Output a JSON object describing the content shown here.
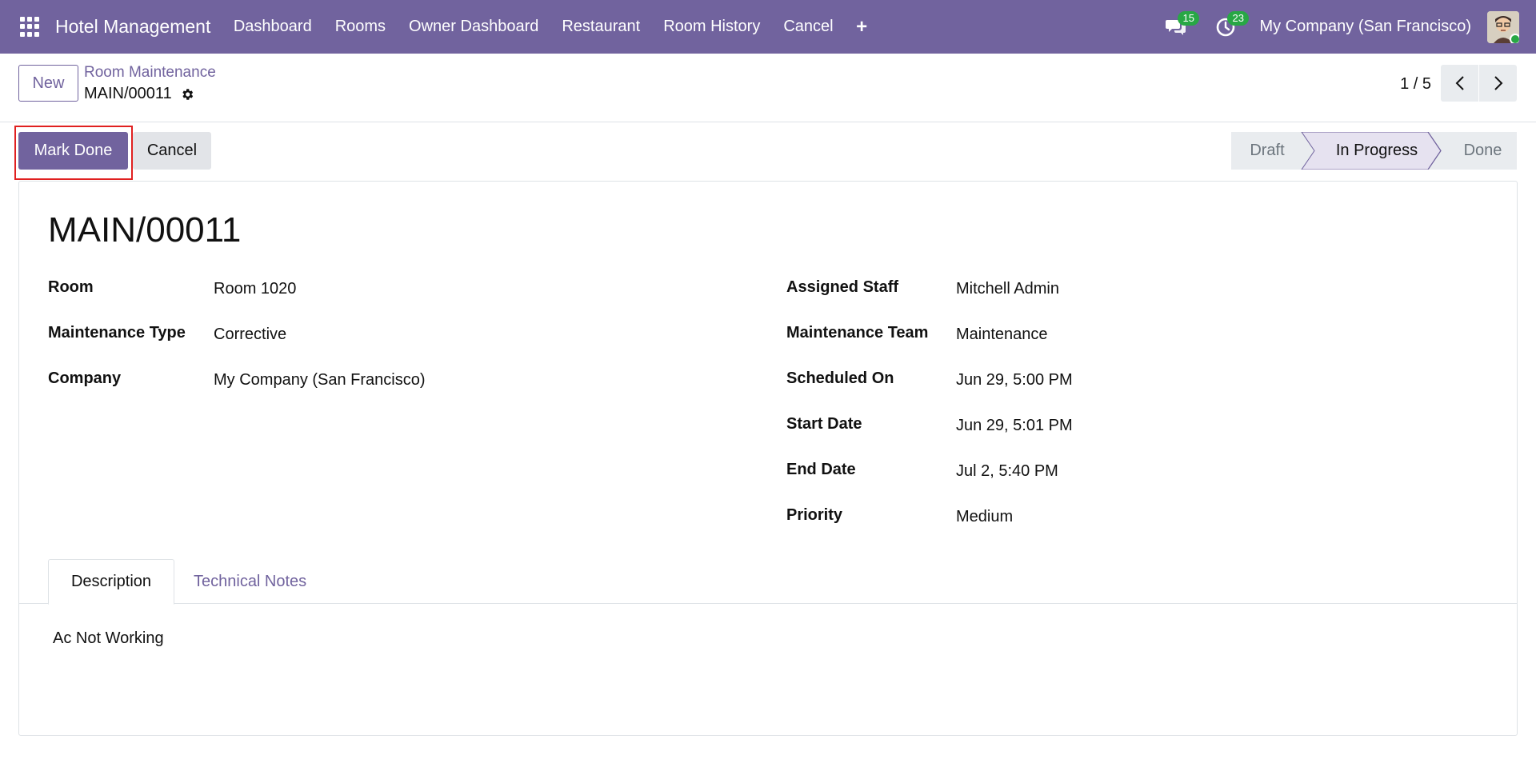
{
  "navbar": {
    "app_name": "Hotel Management",
    "menu": [
      "Dashboard",
      "Rooms",
      "Owner Dashboard",
      "Restaurant",
      "Room History",
      "Cancel"
    ],
    "plus": "+",
    "messages_count": "15",
    "activities_count": "23",
    "company": "My Company (San Francisco)"
  },
  "control": {
    "new_label": "New",
    "breadcrumb_parent": "Room Maintenance",
    "breadcrumb_current": "MAIN/00011",
    "pager": "1 / 5"
  },
  "statusbar": {
    "mark_done_label": "Mark Done",
    "cancel_label": "Cancel",
    "stages": [
      "Draft",
      "In Progress",
      "Done"
    ],
    "current_stage": "In Progress"
  },
  "form": {
    "title": "MAIN/00011",
    "left_fields": [
      {
        "label": "Room",
        "value": "Room 1020"
      },
      {
        "label": "Maintenance Type",
        "value": "Corrective"
      },
      {
        "label": "Company",
        "value": "My Company (San Francisco)"
      }
    ],
    "right_fields": [
      {
        "label": "Assigned Staff",
        "value": "Mitchell Admin"
      },
      {
        "label": "Maintenance Team",
        "value": "Maintenance"
      },
      {
        "label": "Scheduled On",
        "value": "Jun 29, 5:00 PM"
      },
      {
        "label": "Start Date",
        "value": "Jun 29, 5:01 PM"
      },
      {
        "label": "End Date",
        "value": "Jul 2, 5:40 PM"
      },
      {
        "label": "Priority",
        "value": "Medium"
      }
    ],
    "tabs": [
      "Description",
      "Technical Notes"
    ],
    "description": "Ac Not Working"
  },
  "colors": {
    "brand": "#71639e",
    "badge": "#28a745",
    "highlight": "#e02020"
  }
}
